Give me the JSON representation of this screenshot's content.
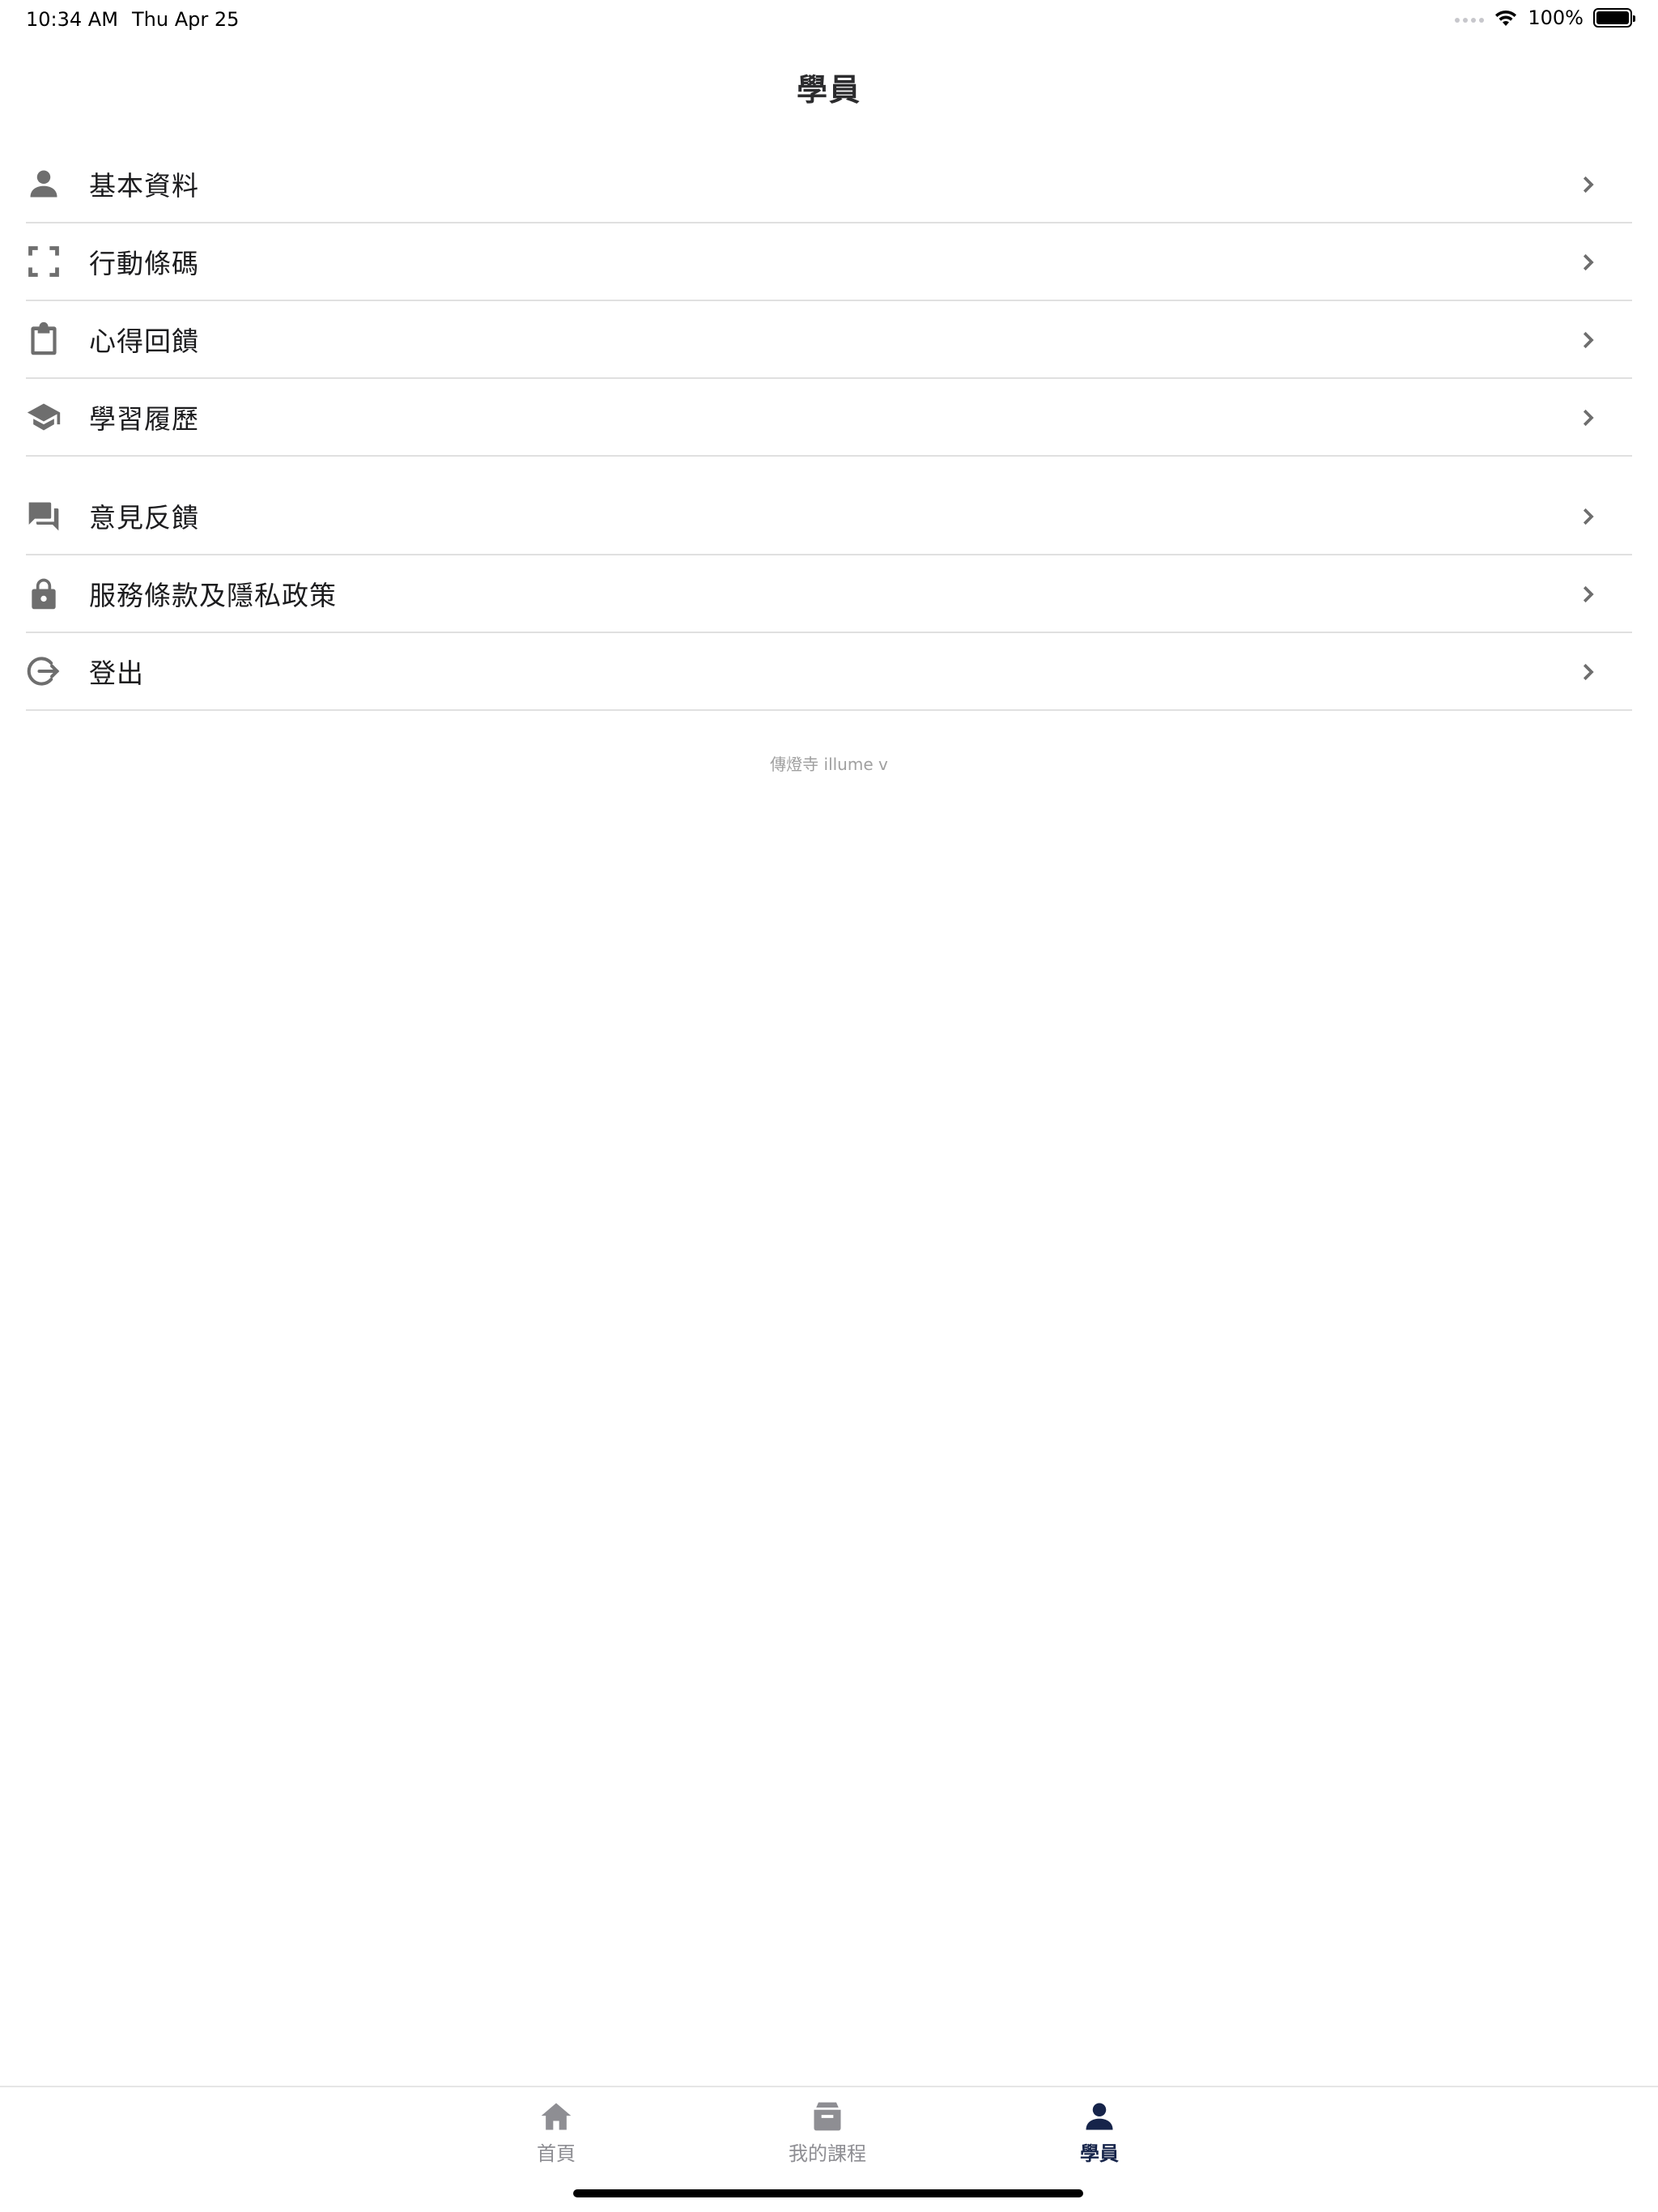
{
  "status_bar": {
    "time": "10:34 AM",
    "date": "Thu Apr 25",
    "battery": "100%"
  },
  "nav": {
    "title": "學員"
  },
  "menu_group_1": [
    {
      "label": "基本資料",
      "icon": "person-icon"
    },
    {
      "label": "行動條碼",
      "icon": "scan-frame-icon"
    },
    {
      "label": "心得回饋",
      "icon": "clipboard-icon"
    },
    {
      "label": "學習履歷",
      "icon": "graduation-cap-icon"
    }
  ],
  "menu_group_2": [
    {
      "label": "意見反饋",
      "icon": "chat-bubbles-icon"
    },
    {
      "label": "服務條款及隱私政策",
      "icon": "lock-icon"
    },
    {
      "label": "登出",
      "icon": "logout-icon"
    }
  ],
  "footer": {
    "version": "傳燈寺 illume v"
  },
  "tab_bar": {
    "tabs": [
      {
        "label": "首頁",
        "icon": "home-icon",
        "active": false
      },
      {
        "label": "我的課程",
        "icon": "inbox-icon",
        "active": false
      },
      {
        "label": "學員",
        "icon": "person-icon",
        "active": true
      }
    ],
    "active_color": "#16244a",
    "inactive_color": "#8e8e93"
  }
}
